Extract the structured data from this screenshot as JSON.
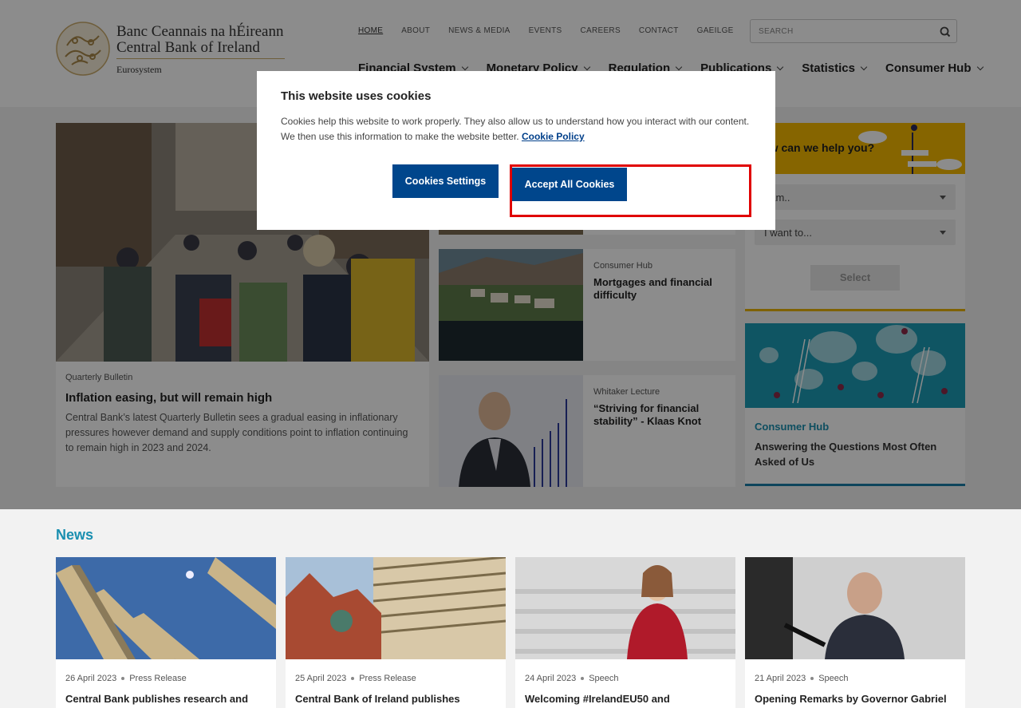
{
  "header": {
    "logo": {
      "irish": "Banc Ceannais na hÉireann",
      "english": "Central Bank of Ireland",
      "sub": "Eurosystem"
    },
    "util_nav": [
      "HOME",
      "ABOUT",
      "NEWS & MEDIA",
      "EVENTS",
      "CAREERS",
      "CONTACT",
      "GAEILGE"
    ],
    "search": {
      "placeholder": "SEARCH"
    },
    "main_nav": [
      "Financial System",
      "Monetary Policy",
      "Regulation",
      "Publications",
      "Statistics",
      "Consumer Hub"
    ]
  },
  "featured": {
    "big": {
      "kicker": "Quarterly Bulletin",
      "title": "Inflation easing, but will remain high",
      "desc": "Central Bank’s latest Quarterly Bulletin sees a gradual easing in inflationary pressures however demand and supply conditions point to inflation continuing to remain high in 2023 and 2024."
    },
    "small": [
      {
        "kicker": "Consumer Hub",
        "title": "Mortgages and financial difficulty"
      },
      {
        "kicker": "Whitaker Lecture",
        "title": "“Striving for financial stability” - Klaas Knot"
      }
    ]
  },
  "help": {
    "title": "How can we help you?",
    "select_i_am": "I am..",
    "select_i_want": "I want to...",
    "select_button": "Select"
  },
  "consumer": {
    "kicker": "Consumer Hub",
    "title": "Answering the Questions Most Often Asked of Us"
  },
  "news": {
    "heading": "News",
    "items": [
      {
        "date": "26 April 2023",
        "type": "Press Release",
        "title": "Central Bank publishes research and"
      },
      {
        "date": "25 April 2023",
        "type": "Press Release",
        "title": "Central Bank of Ireland publishes"
      },
      {
        "date": "24 April 2023",
        "type": "Speech",
        "title": "Welcoming #IrelandEU50 and"
      },
      {
        "date": "21 April 2023",
        "type": "Speech",
        "title": "Opening Remarks by Governor Gabriel"
      }
    ]
  },
  "cookie": {
    "title": "This website uses cookies",
    "text": "Cookies help this website to work properly. They also allow us to understand how you interact with our content. We then use this information to make the website better.",
    "link": "Cookie Policy",
    "settings_button": "Cookies Settings",
    "accept_button": "Accept All Cookies"
  },
  "colors": {
    "primary": "#00468c",
    "accent_teal": "#1a8fb0",
    "accent_yellow": "#f5b800",
    "highlight": "#e00000"
  }
}
